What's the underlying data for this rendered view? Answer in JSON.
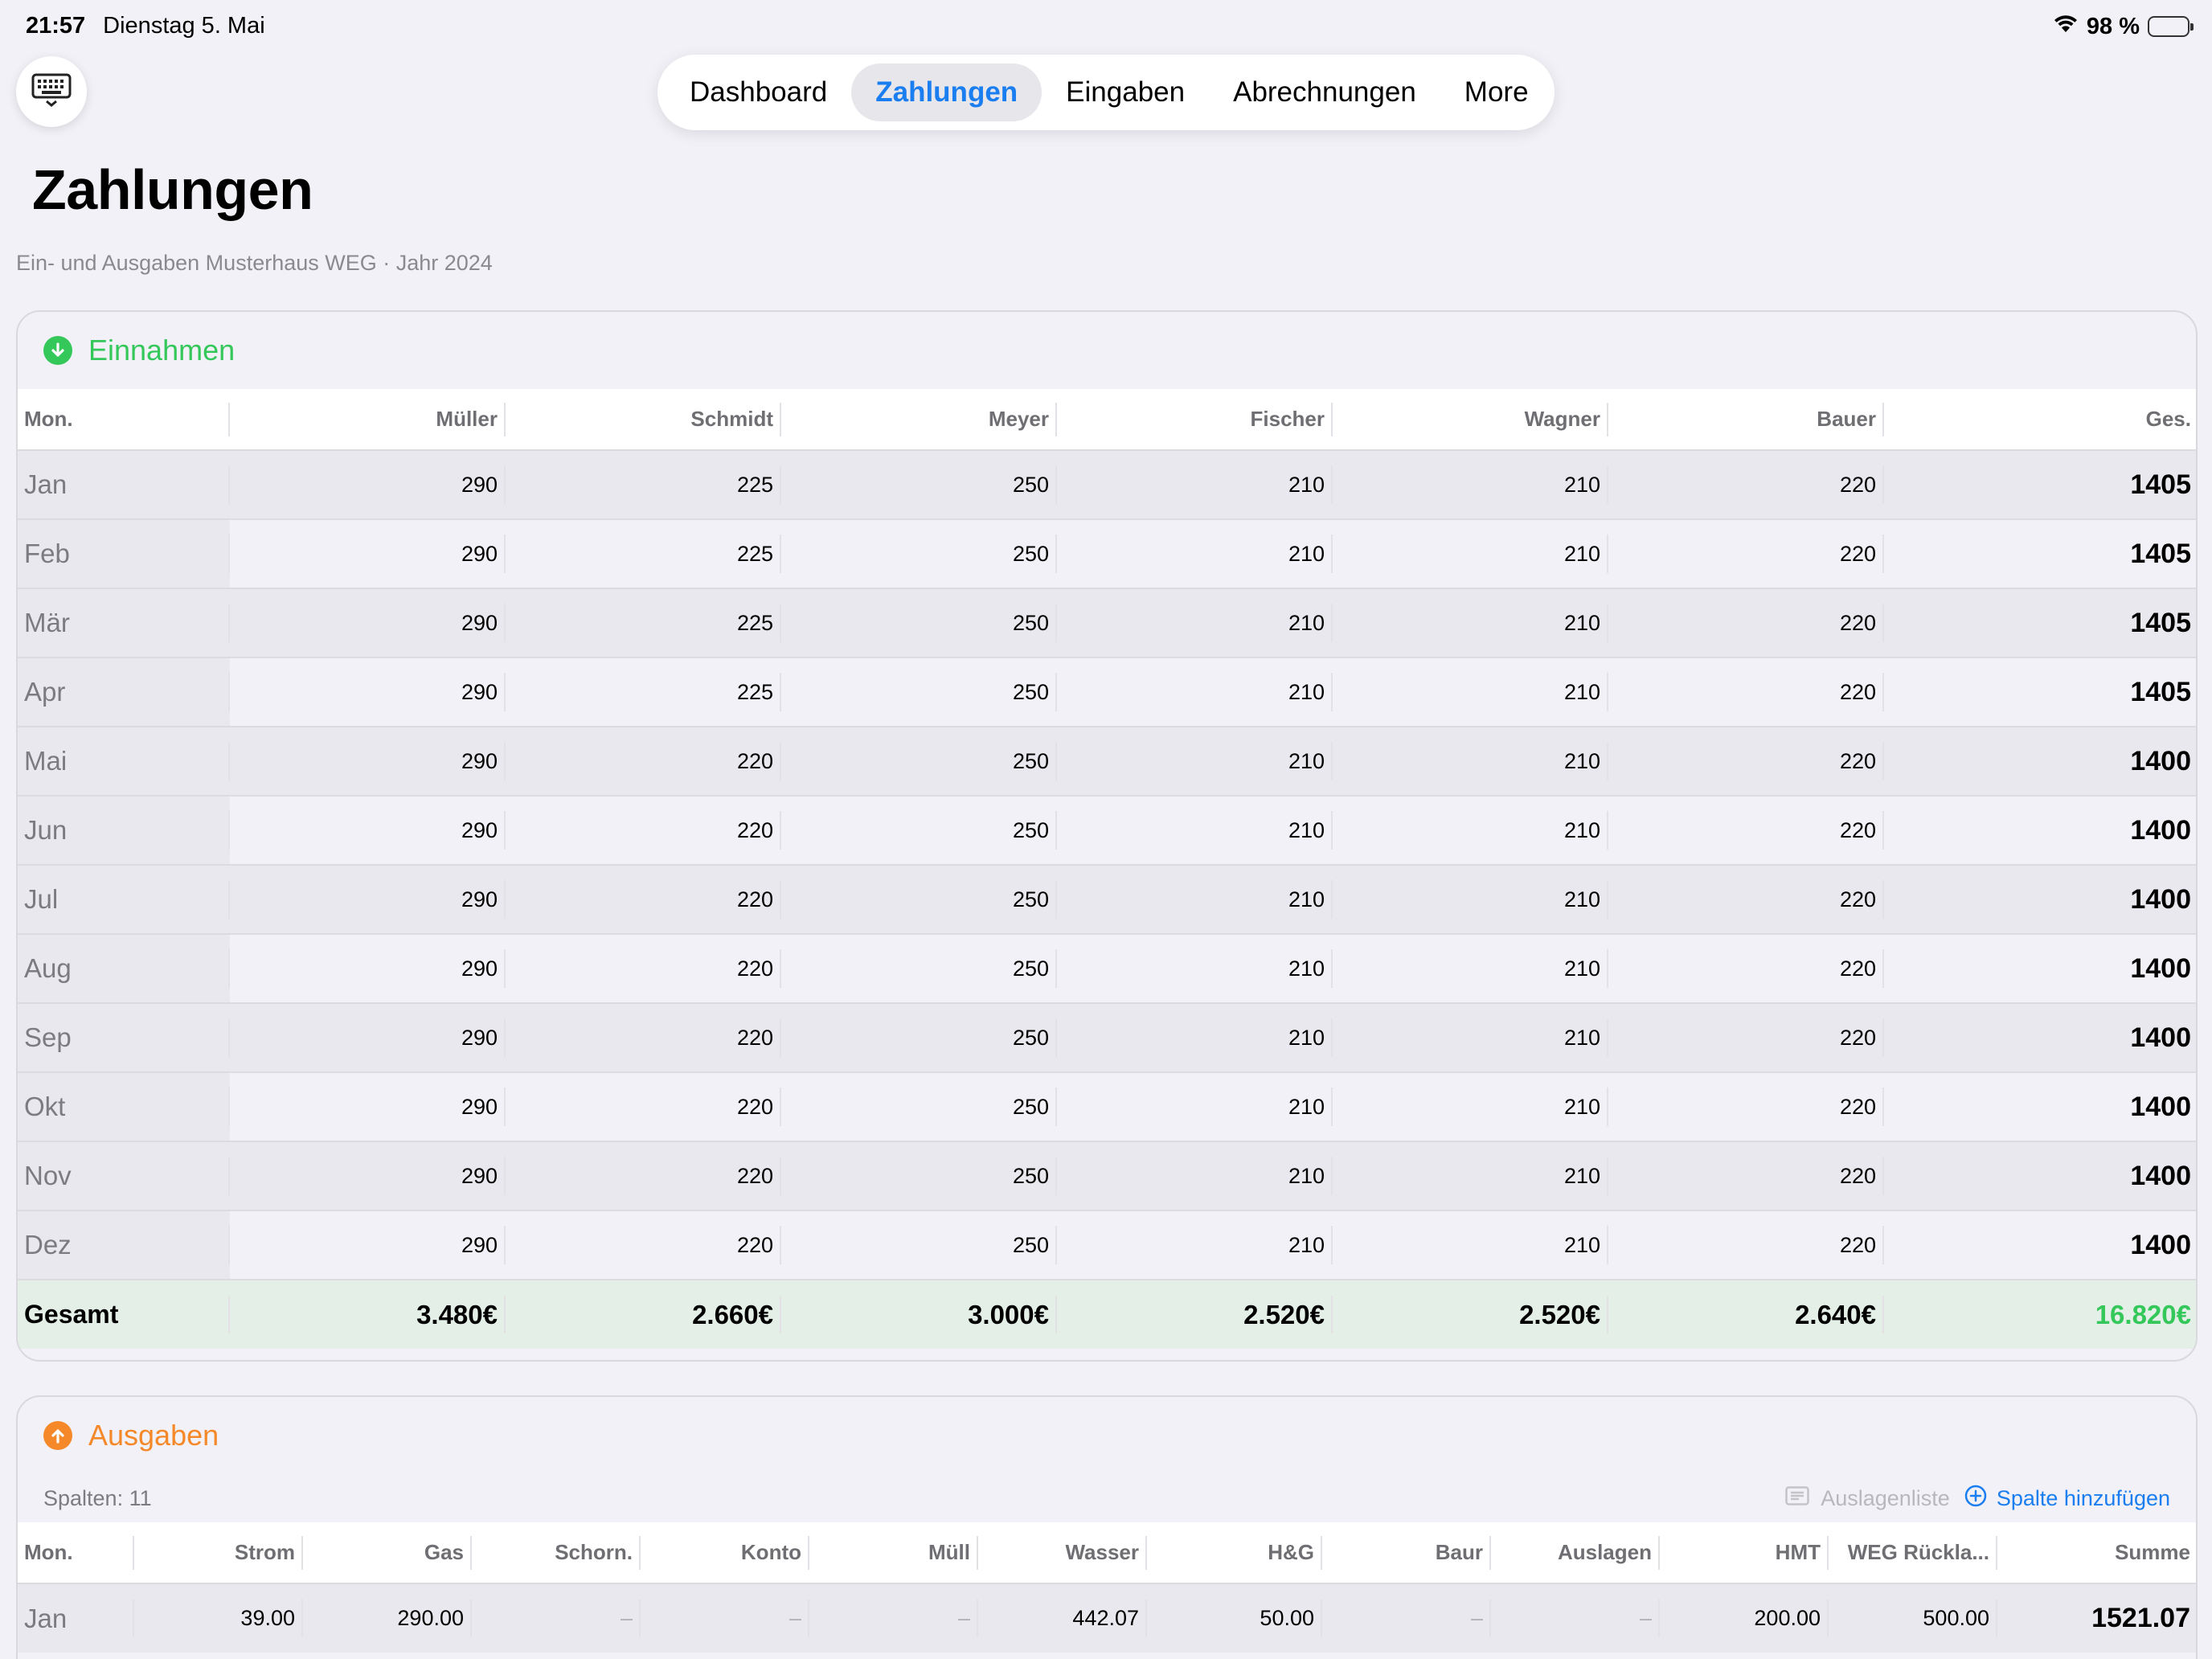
{
  "status": {
    "time": "21:57",
    "date": "Dienstag 5. Mai",
    "battery": "98 %"
  },
  "nav": {
    "tabs": [
      "Dashboard",
      "Zahlungen",
      "Eingaben",
      "Abrechnungen",
      "More"
    ],
    "active": "Zahlungen"
  },
  "page": {
    "title": "Zahlungen",
    "subtitle": "Ein- und Ausgaben Musterhaus WEG · Jahr 2024"
  },
  "einnahmen": {
    "title": "Einnahmen",
    "color": "#34c759",
    "columns": [
      "Mon.",
      "Müller",
      "Schmidt",
      "Meyer",
      "Fischer",
      "Wagner",
      "Bauer",
      "Ges."
    ],
    "rows": [
      [
        "Jan",
        "290",
        "225",
        "250",
        "210",
        "210",
        "220",
        "1405"
      ],
      [
        "Feb",
        "290",
        "225",
        "250",
        "210",
        "210",
        "220",
        "1405"
      ],
      [
        "Mär",
        "290",
        "225",
        "250",
        "210",
        "210",
        "220",
        "1405"
      ],
      [
        "Apr",
        "290",
        "225",
        "250",
        "210",
        "210",
        "220",
        "1405"
      ],
      [
        "Mai",
        "290",
        "220",
        "250",
        "210",
        "210",
        "220",
        "1400"
      ],
      [
        "Jun",
        "290",
        "220",
        "250",
        "210",
        "210",
        "220",
        "1400"
      ],
      [
        "Jul",
        "290",
        "220",
        "250",
        "210",
        "210",
        "220",
        "1400"
      ],
      [
        "Aug",
        "290",
        "220",
        "250",
        "210",
        "210",
        "220",
        "1400"
      ],
      [
        "Sep",
        "290",
        "220",
        "250",
        "210",
        "210",
        "220",
        "1400"
      ],
      [
        "Okt",
        "290",
        "220",
        "250",
        "210",
        "210",
        "220",
        "1400"
      ],
      [
        "Nov",
        "290",
        "220",
        "250",
        "210",
        "210",
        "220",
        "1400"
      ],
      [
        "Dez",
        "290",
        "220",
        "250",
        "210",
        "210",
        "220",
        "1400"
      ]
    ],
    "total": [
      "Gesamt",
      "3.480€",
      "2.660€",
      "3.000€",
      "2.520€",
      "2.520€",
      "2.640€",
      "16.820€"
    ]
  },
  "ausgaben": {
    "title": "Ausgaben",
    "color": "#f5892a",
    "columns_count": "Spalten: 11",
    "auslagenliste": "Auslagenliste",
    "add_column": "Spalte hinzufügen",
    "columns": [
      "Mon.",
      "Strom",
      "Gas",
      "Schorn.",
      "Konto",
      "Müll",
      "Wasser",
      "H&G",
      "Baur",
      "Auslagen",
      "HMT",
      "WEG Rückla...",
      "Summe"
    ],
    "rows": [
      [
        "Jan",
        "39.00",
        "290.00",
        "–",
        "–",
        "–",
        "442.07",
        "50.00",
        "–",
        "–",
        "200.00",
        "500.00",
        "1521.07"
      ]
    ]
  }
}
